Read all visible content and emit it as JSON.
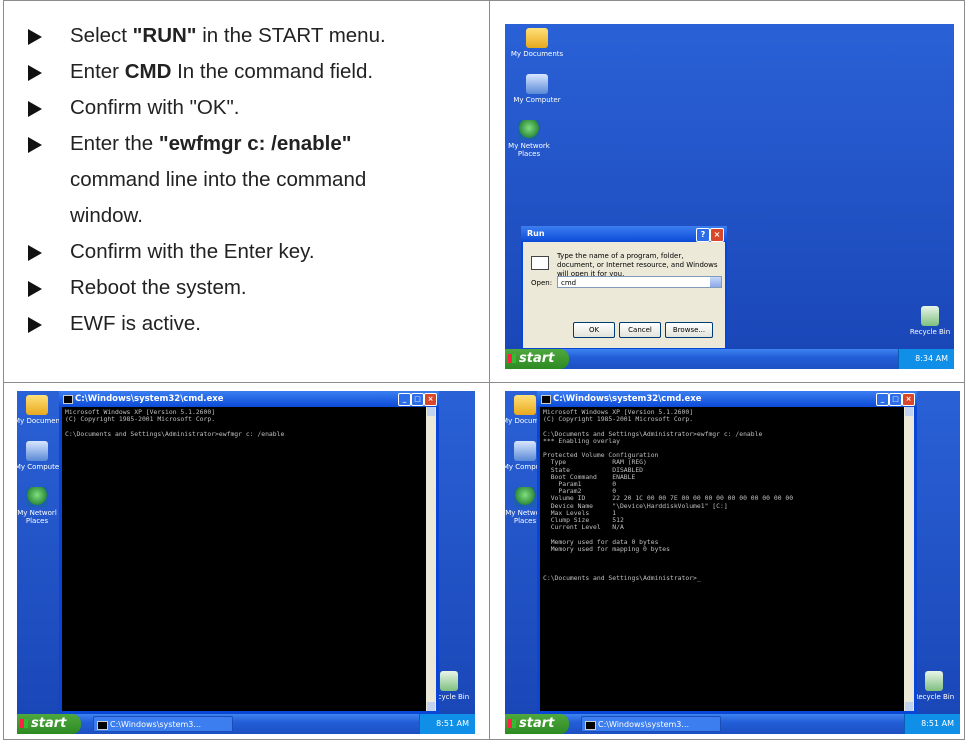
{
  "steps": [
    {
      "pre": "Select ",
      "bold": "\"RUN\"",
      "post": " in the START menu."
    },
    {
      "pre": "Enter ",
      "bold": "CMD",
      "post": " In the command field."
    },
    {
      "pre": "Confirm with \"OK\".",
      "bold": "",
      "post": ""
    },
    {
      "pre": "Enter the ",
      "bold": "\"ewfmgr c: /enable\"",
      "post": " command line into the command window."
    },
    {
      "pre": "Confirm with the Enter key.",
      "bold": "",
      "post": ""
    },
    {
      "pre": "Reboot the system.",
      "bold": "",
      "post": ""
    },
    {
      "pre": "EWF is active.",
      "bold": "",
      "post": ""
    }
  ],
  "desktop": {
    "icons": {
      "documents": "My Documents",
      "documents_short": "My Documen",
      "computer": "My Computer",
      "computer_short": "My Compute",
      "network": "My Network Places",
      "network_short": "My Networl Places",
      "recycle": "Recycle Bin"
    },
    "start": "start"
  },
  "run_dialog": {
    "title": "Run",
    "description": "Type the name of a program, folder, document, or Internet resource, and Windows will open it for you.",
    "open_label": "Open:",
    "value": "cmd",
    "ok": "OK",
    "cancel": "Cancel",
    "browse": "Browse...",
    "clock": "8:34 AM"
  },
  "cmd1": {
    "title": "C:\\Windows\\system32\\cmd.exe",
    "task": "C:\\Windows\\system3...",
    "clock": "8:51 AM",
    "text": "Microsoft Windows XP [Version 5.1.2600]\n(C) Copyright 1985-2001 Microsoft Corp.\n\nC:\\Documents and Settings\\Administrator>ewfmgr c: /enable"
  },
  "cmd2": {
    "title": "C:\\Windows\\system32\\cmd.exe",
    "task": "C:\\Windows\\system3...",
    "clock": "8:51 AM",
    "text": "Microsoft Windows XP [Version 5.1.2600]\n(C) Copyright 1985-2001 Microsoft Corp.\n\nC:\\Documents and Settings\\Administrator>ewfmgr c: /enable\n*** Enabling overlay\n\nProtected Volume Configuration\n  Type            RAM (REG)\n  State           DISABLED\n  Boot Command    ENABLE\n    Param1        0\n    Param2        0\n  Volume ID       22 20 1C 00 00 7E 00 00 00 00 00 00 00 00 00 00\n  Device Name     \"\\Device\\HarddiskVolume1\" [C:]\n  Max Levels      1\n  Clump Size      512\n  Current Level   N/A\n\n  Memory used for data 0 bytes\n  Memory used for mapping 0 bytes\n\n\n\nC:\\Documents and Settings\\Administrator>_"
  }
}
